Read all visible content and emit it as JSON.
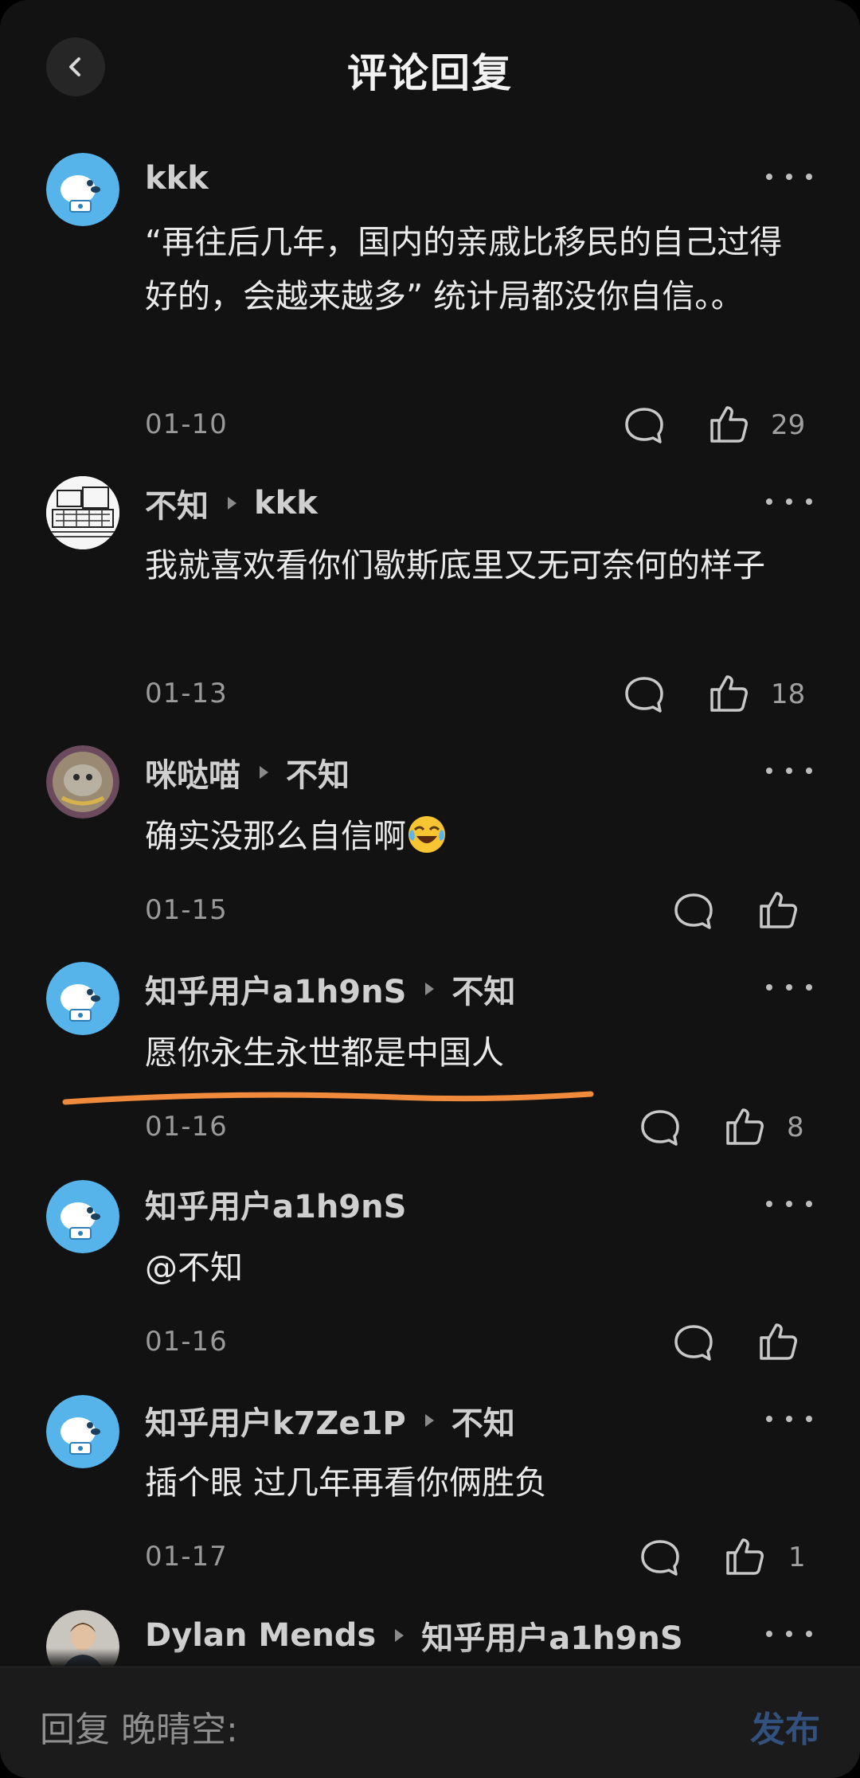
{
  "header": {
    "title": "评论回复"
  },
  "comments": [
    {
      "author": "kkk",
      "reply_to": "",
      "text": "“再往后几年，国内的亲戚比移民的自己过得好的，会越来越多” 统计局都没你自信。。",
      "date": "01-10",
      "likes": "29"
    },
    {
      "author": "不知",
      "reply_to": "kkk",
      "text": "我就喜欢看你们歇斯底里又无可奈何的样子",
      "date": "01-13",
      "likes": "18"
    },
    {
      "author": "咪哒喵",
      "reply_to": "不知",
      "text": "确实没那么自信啊",
      "date": "01-15",
      "likes": ""
    },
    {
      "author": "知乎用户a1h9nS",
      "reply_to": "不知",
      "text": "愿你永生永世都是中国人",
      "date": "01-16",
      "likes": "8"
    },
    {
      "author": "知乎用户a1h9nS",
      "reply_to": "",
      "text": "@不知",
      "date": "01-16",
      "likes": ""
    },
    {
      "author": "知乎用户k7Ze1P",
      "reply_to": "不知",
      "text": "插个眼 过几年再看你俩胜负",
      "date": "01-17",
      "likes": "1"
    },
    {
      "author": "Dylan Mends",
      "reply_to": "知乎用户a1h9nS",
      "text": "",
      "date": "",
      "likes": ""
    }
  ],
  "reply_bar": {
    "placeholder": "回复 晚晴空:",
    "publish_label": "发布"
  },
  "colors": {
    "background": "#121212",
    "accent_underline": "#f08a3c",
    "publish": "#33517f"
  },
  "icons": {
    "back": "chevron-left-icon",
    "more": "more-dots-icon",
    "comment": "comment-bubble-icon",
    "like": "thumbs-up-icon",
    "emoji": "crying-laughing-emoji"
  }
}
